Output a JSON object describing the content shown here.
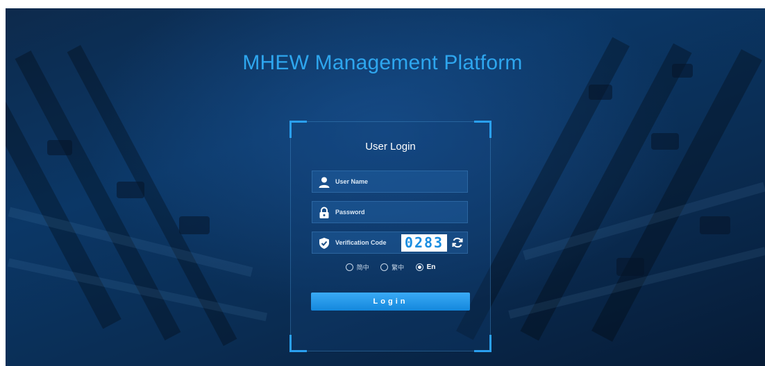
{
  "page": {
    "title": "MHEW Management Platform"
  },
  "login": {
    "heading": "User Login",
    "username": {
      "placeholder": "User Name",
      "value": "",
      "icon": "user-icon"
    },
    "password": {
      "placeholder": "Password",
      "value": "",
      "icon": "lock-icon"
    },
    "verification": {
      "placeholder": "Verification Code",
      "value": "",
      "icon": "shield-check-icon",
      "captcha": "0283",
      "refresh_icon": "refresh-icon"
    },
    "languages": [
      {
        "label": "简中",
        "selected": false
      },
      {
        "label": "繁中",
        "selected": false
      },
      {
        "label": "En",
        "selected": true
      }
    ],
    "submit_label": "Login"
  },
  "colors": {
    "accent": "#2ea6ee",
    "button": "#1a8fe3",
    "background": "#0b3766"
  }
}
